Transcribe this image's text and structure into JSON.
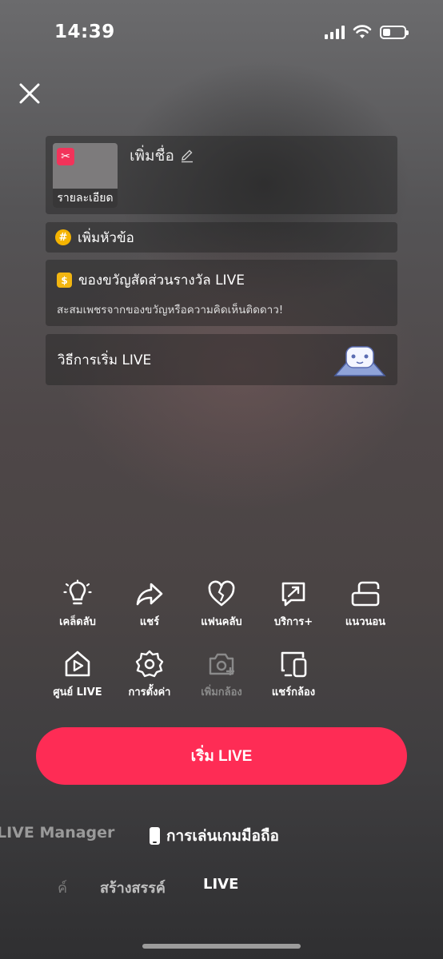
{
  "status_bar": {
    "time": "14:39",
    "battery_level": 0.25,
    "icons": [
      "signal-icon",
      "wifi-icon",
      "battery-icon"
    ]
  },
  "setup": {
    "close_icon": "close-icon",
    "cover_label": "รายละเอียด",
    "title_placeholder": "เพิ่มชื่อ",
    "topic_label": "เพิ่มหัวข้อ",
    "gift": {
      "title": "ของขวัญสัดส่วนรางวัล LIVE",
      "subtitle": "สะสมเพชรจากของขวัญหรือความคิดเห็นติดดาว!"
    },
    "howto_label": "วิธีการเริ่ม LIVE"
  },
  "tools": [
    {
      "label": "เคล็ดลับ",
      "icon": "lightbulb-icon"
    },
    {
      "label": "แชร์",
      "icon": "share-icon"
    },
    {
      "label": "แฟนคลับ",
      "icon": "heart-icon"
    },
    {
      "label": "บริการ+",
      "icon": "service-icon"
    },
    {
      "label": "แนวนอน",
      "icon": "landscape-icon"
    },
    {
      "label": "ศูนย์ LIVE",
      "icon": "live-center-icon"
    },
    {
      "label": "การตั้งค่า",
      "icon": "settings-gear-icon"
    },
    {
      "label": "เพิ่มกล้อง",
      "icon": "add-camera-icon",
      "disabled": true
    },
    {
      "label": "แชร์กล้อง",
      "icon": "share-camera-icon"
    }
  ],
  "start_button_label": "เริ่ม LIVE",
  "modes": {
    "manager": "LIVE Manager",
    "mobile_gaming": "การเล่นเกมมือถือ"
  },
  "bottom_tabs": {
    "partial": "ค์",
    "create": "สร้างสรรค์",
    "live": "LIVE"
  },
  "colors": {
    "accent": "#fe2c55",
    "topic_badge": "#f5b400",
    "coin": "#f3b611"
  }
}
